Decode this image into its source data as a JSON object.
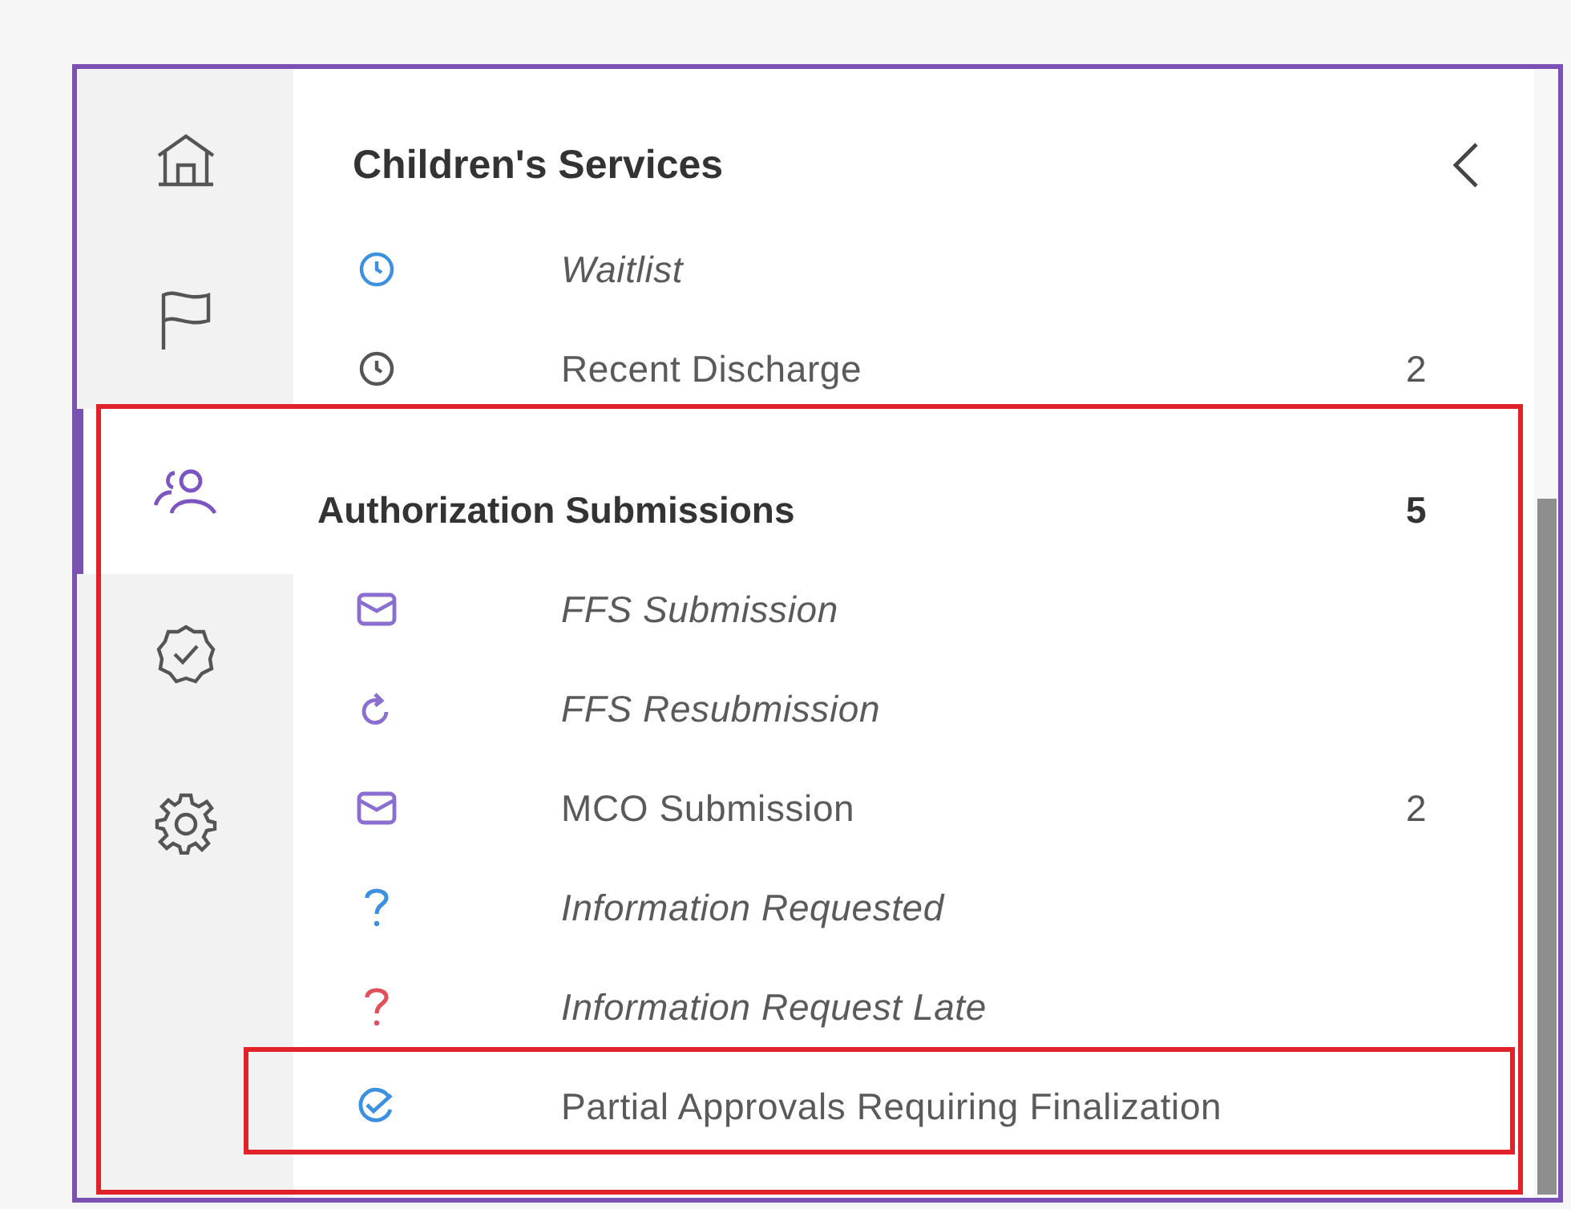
{
  "rail": [
    {
      "kind": "home",
      "selected": false
    },
    {
      "kind": "flag",
      "selected": false
    },
    {
      "kind": "people",
      "selected": true
    },
    {
      "kind": "badge",
      "selected": false
    },
    {
      "kind": "gear",
      "selected": false
    }
  ],
  "panel": {
    "title": "Children's Services",
    "items": [
      {
        "label": "Waitlist",
        "kind": "clock",
        "color": "#3d8fe0",
        "italic": true,
        "highlighted": false
      },
      {
        "label": "Recent Discharge",
        "kind": "clock",
        "color": "#555555",
        "italic": false,
        "count": "2",
        "highlighted": false
      }
    ]
  },
  "section": {
    "title": "Authorization Submissions",
    "count": "5",
    "highlighted": true,
    "items": [
      {
        "label": "FFS Submission",
        "kind": "mail",
        "color": "#8a6fd0",
        "italic": true,
        "highlighted": false
      },
      {
        "label": "FFS Resubmission",
        "kind": "refresh",
        "color": "#8a6fd0",
        "italic": true,
        "highlighted": false
      },
      {
        "label": "MCO Submission",
        "kind": "mail",
        "color": "#8a6fd0",
        "italic": false,
        "count": "2",
        "highlighted": false
      },
      {
        "label": "Information Requested",
        "kind": "question",
        "color": "#3d8fe0",
        "italic": true,
        "highlighted": false
      },
      {
        "label": "Information Request Late",
        "kind": "question",
        "color": "#e0505a",
        "italic": true,
        "highlighted": false
      },
      {
        "label": "Partial Approvals Requiring Finalization",
        "kind": "check-circle",
        "color": "#3d8fe0",
        "italic": false,
        "highlighted": true
      }
    ]
  }
}
